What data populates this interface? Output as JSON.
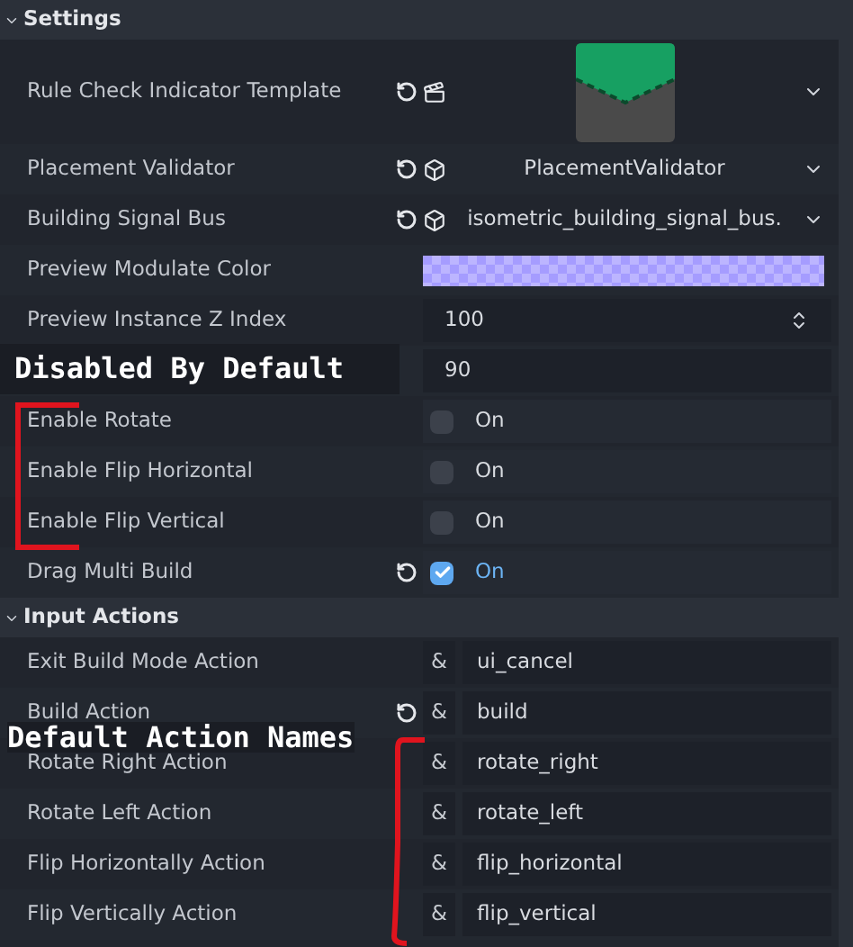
{
  "sections": [
    {
      "title": "Settings",
      "expanded": true,
      "rows": [
        {
          "kind": "resource",
          "label": "Rule Check Indicator Template",
          "revertable": true
        },
        {
          "kind": "object",
          "label": "Placement Validator",
          "revertable": true,
          "value": "PlacementValidator"
        },
        {
          "kind": "object",
          "label": "Building Signal Bus",
          "revertable": true,
          "value": "isometric_building_signal_bus."
        },
        {
          "kind": "color",
          "label": "Preview Modulate Color",
          "revertable": false,
          "color": "#a59cff"
        },
        {
          "kind": "spin",
          "label": "Preview Instance Z Index",
          "revertable": false,
          "value": "100"
        },
        {
          "kind": "number",
          "revertable": false,
          "value": "90"
        },
        {
          "kind": "check",
          "label": "Enable Rotate",
          "revertable": false,
          "checked": false,
          "value": "On"
        },
        {
          "kind": "check",
          "label": "Enable Flip Horizontal",
          "revertable": false,
          "checked": false,
          "value": "On"
        },
        {
          "kind": "check",
          "label": "Enable Flip Vertical",
          "revertable": false,
          "checked": false,
          "value": "On"
        },
        {
          "kind": "check",
          "label": "Drag Multi Build",
          "revertable": true,
          "checked": true,
          "value": "On"
        }
      ]
    },
    {
      "title": "Input Actions",
      "expanded": true,
      "rows": [
        {
          "kind": "action",
          "label": "Exit Build Mode Action",
          "revertable": false,
          "prefix": "&",
          "value": "ui_cancel"
        },
        {
          "kind": "action",
          "label": "Build Action",
          "revertable": true,
          "prefix": "&",
          "value": "build"
        },
        {
          "kind": "action",
          "label": "Rotate Right Action",
          "revertable": false,
          "prefix": "&",
          "value": "rotate_right"
        },
        {
          "kind": "action",
          "label": "Rotate Left Action",
          "revertable": false,
          "prefix": "&",
          "value": "rotate_left"
        },
        {
          "kind": "action",
          "label": "Flip Horizontally Action",
          "revertable": false,
          "prefix": "&",
          "value": "flip_horizontal"
        },
        {
          "kind": "action",
          "label": "Flip Vertically Action",
          "revertable": false,
          "prefix": "&",
          "value": "flip_vertical"
        }
      ]
    }
  ],
  "annotations": [
    {
      "text": "Disabled By Default"
    },
    {
      "text": "Default Action Names"
    }
  ]
}
